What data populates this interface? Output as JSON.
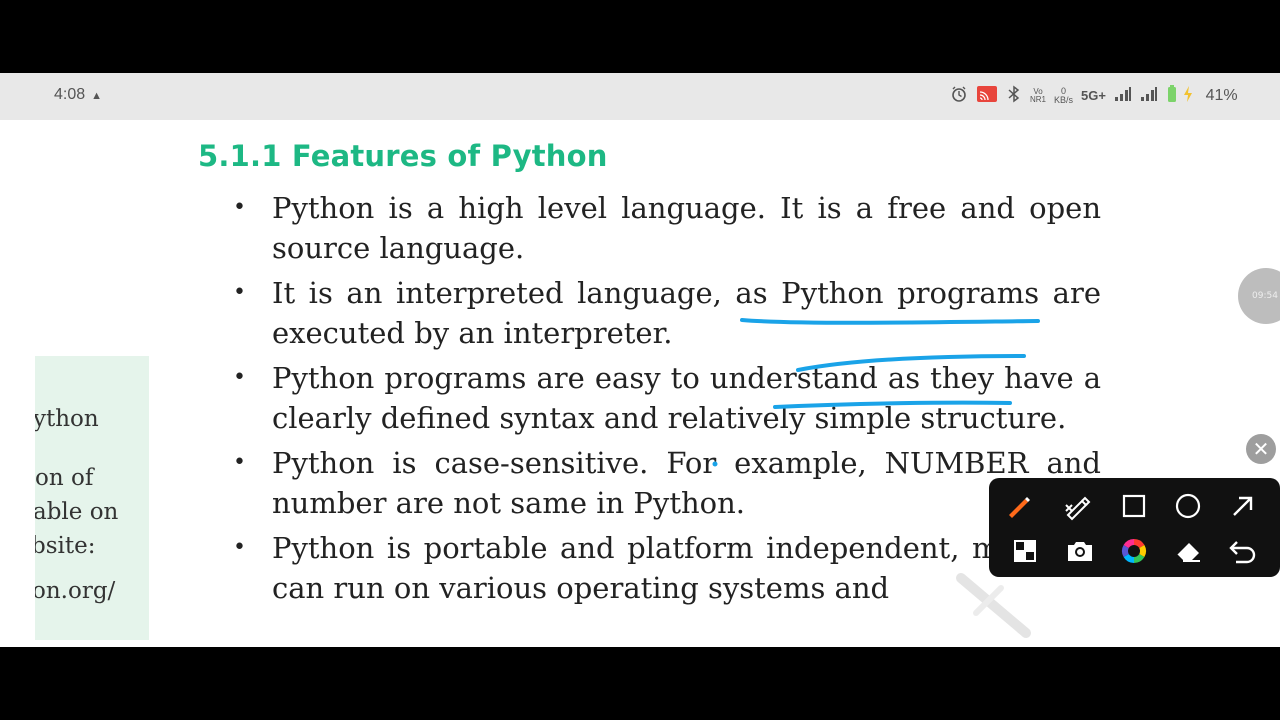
{
  "status_bar": {
    "time": "4:08",
    "warning_glyph": "▲",
    "network_speed_top": "0",
    "network_speed_bottom": "KB/s",
    "volte_top": "Vo",
    "volte_bottom": "NR1",
    "network_type": "5G+",
    "battery": "41%",
    "icons": [
      "alarm-icon",
      "cast-icon",
      "bluetooth-icon",
      "signal-icon",
      "signal-icon",
      "battery-icon"
    ]
  },
  "document": {
    "heading": "5.1.1 Features of Python",
    "bullet_glyph": "•",
    "items": [
      "Python is a high level language. It is a free and open source language.",
      "It is an interpreted language, as Python programs are executed by an interpreter.",
      "Python programs are easy to understand as they have a clearly defined syntax and relatively simple structure.",
      "Python is case-sensitive. For example, NUMBER and number are not same in Python.",
      "Python is portable and platform independent, means it can run on various operating systems and"
    ],
    "sidebox": {
      "line1": "ython",
      "line2": "on of",
      "line3": "able on",
      "line4": "bsite:",
      "line5": "on.org/"
    }
  },
  "overlay": {
    "float_button_label": "09:54",
    "close_glyph": "✕",
    "toolbar_icons": [
      "pen-icon",
      "eraser-marker-icon",
      "rectangle-icon",
      "circle-icon",
      "arrow-icon",
      "pixelate-icon",
      "camera-icon",
      "color-wheel-icon",
      "eraser-icon",
      "undo-icon"
    ],
    "accent_color": "#1aa3e8"
  }
}
